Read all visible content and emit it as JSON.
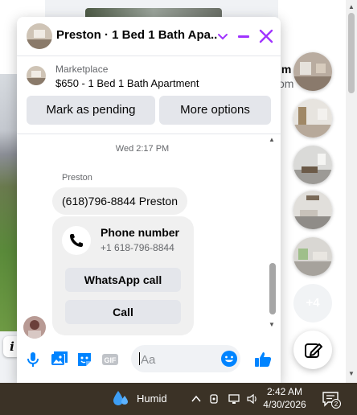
{
  "chat": {
    "title": "Preston · 1 Bed 1 Bath Apa...",
    "listing": {
      "label": "Marketplace",
      "title": "$650 - 1 Bed 1 Bath Apartment",
      "mark_pending": "Mark as pending",
      "more_options": "More options"
    },
    "messages": {
      "timestamp": "Wed 2:17 PM",
      "sender": "Preston",
      "text": "(618)796-8844 Preston",
      "card": {
        "title": "Phone number",
        "number": "+1 618-796-8844",
        "whatsapp": "WhatsApp call",
        "call": "Call"
      }
    },
    "composer": {
      "placeholder": "Aa",
      "gif_label": "GIF"
    },
    "accent": "#a033ff",
    "brand_blue": "#0084ff"
  },
  "background": {
    "partial_name": "im",
    "partial_sub": "om",
    "info_label": "i",
    "more_chats": "+4"
  },
  "taskbar": {
    "weather": "Humid",
    "time": "2:42 AM",
    "date": "4/30/2026",
    "notifications": "2"
  }
}
